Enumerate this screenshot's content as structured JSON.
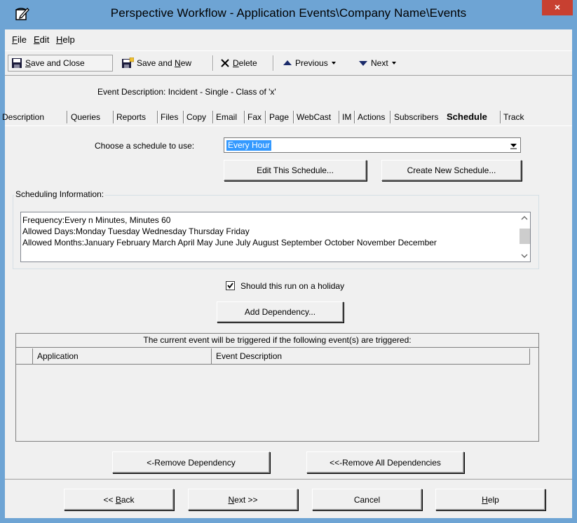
{
  "window": {
    "title": "Perspective Workflow - Application Events\\Company Name\\Events",
    "close_label": "×"
  },
  "menu": {
    "file_accel": "F",
    "file_rest": "ile",
    "edit_accel": "E",
    "edit_rest": "dit",
    "help_accel": "H",
    "help_rest": "elp"
  },
  "toolbar": {
    "save_close_accel": "S",
    "save_close_rest": "ave and Close",
    "save_new_pre": "Save and ",
    "save_new_accel": "N",
    "save_new_rest": "ew",
    "delete_accel": "D",
    "delete_rest": "elete",
    "previous_label": "Previous",
    "next_label": "Next"
  },
  "event_description": "Event Description:  Incident - Single - Class of 'x'",
  "tabs": [
    {
      "label": "Description"
    },
    {
      "label": "Queries"
    },
    {
      "label": "Reports"
    },
    {
      "label": "Files"
    },
    {
      "label": "Copy"
    },
    {
      "label": "Email"
    },
    {
      "label": "Fax"
    },
    {
      "label": "Page"
    },
    {
      "label": "WebCast"
    },
    {
      "label": "IM"
    },
    {
      "label": "Actions"
    },
    {
      "label": "Subscribers"
    },
    {
      "label": "Schedule"
    },
    {
      "label": "Track"
    }
  ],
  "active_tab": "Schedule",
  "schedule": {
    "choose_label": "Choose a schedule to use:",
    "selected": "Every Hour",
    "edit_button": "Edit This Schedule...",
    "create_button": "Create New Schedule..."
  },
  "scheduling_info": {
    "group_title": "Scheduling Information:",
    "lines": [
      "Frequency:Every n Minutes, Minutes 60",
      "Allowed Days:Monday Tuesday Wednesday Thursday Friday",
      "Allowed Months:January February March April May June July August September October November December"
    ]
  },
  "holiday": {
    "label": "Should this run on a holiday",
    "checked": true
  },
  "dependencies": {
    "add_button": "Add Dependency...",
    "caption": "The current event will be triggered if the following event(s) are triggered:",
    "columns": [
      "Application",
      "Event Description"
    ],
    "rows": [],
    "remove_button": "<-Remove Dependency",
    "remove_all_button": "<<-Remove All Dependencies"
  },
  "footer": {
    "back_pre": "<< ",
    "back_accel": "B",
    "back_rest": "ack",
    "next_accel": "N",
    "next_rest": "ext >>",
    "cancel": "Cancel",
    "help_accel": "H",
    "help_rest": "elp"
  }
}
